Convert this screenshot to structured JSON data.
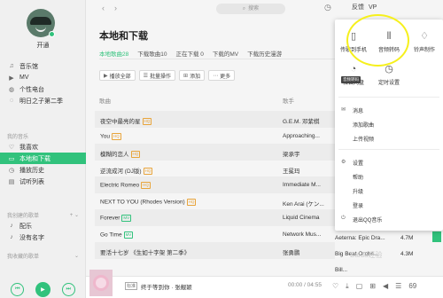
{
  "sidebar": {
    "username": "开通",
    "items": [
      {
        "icon": "♫",
        "label": "音乐馆"
      },
      {
        "icon": "▶",
        "label": "MV"
      },
      {
        "icon": "◍",
        "label": "个性电台"
      },
      {
        "icon": "◌",
        "label": "明日之子第二季"
      }
    ],
    "my_music_head": "我的音乐",
    "my_items": [
      {
        "icon": "♡",
        "label": "我喜欢"
      },
      {
        "icon": "▭",
        "label": "本地和下载"
      },
      {
        "icon": "◷",
        "label": "播放历史"
      },
      {
        "icon": "▤",
        "label": "试听列表"
      }
    ],
    "created_head": "我创建的歌单",
    "created_items": [
      {
        "icon": "♪",
        "label": "配乐"
      },
      {
        "icon": "♪",
        "label": "没有名字"
      }
    ],
    "collected_head": "我收藏的歌单"
  },
  "topbar": {
    "back": "‹",
    "forward": "›",
    "search_placeholder": "搜索",
    "feedback": "反馈",
    "vip": "VP"
  },
  "main": {
    "title": "本地和下载",
    "tabs": [
      "本地歌曲28",
      "下载歌曲10",
      "正在下载 0",
      "下载的MV",
      "下载历史漫游"
    ],
    "actions": [
      {
        "icon": "▶",
        "label": "播放全部"
      },
      {
        "icon": "☰",
        "label": "批量操作"
      },
      {
        "icon": "⊞",
        "label": "添加"
      },
      {
        "icon": "⋯",
        "label": "更多"
      }
    ],
    "headers": {
      "song": "歌曲",
      "artist": "歌手"
    },
    "rows": [
      {
        "title": "夜空中最亮的星",
        "tag": "HQ",
        "artist": "G.E.M. 邓紫棋"
      },
      {
        "title": "You",
        "tag": "HQ",
        "artist": "Approaching..."
      },
      {
        "title": "模糊的恋人",
        "tag": "HQ",
        "artist": "梁承宇"
      },
      {
        "title": "逆流成河 (DJ版)",
        "tag": "HQ",
        "artist": "王冕玛"
      },
      {
        "title": "Electric Romeo",
        "tag": "HQ",
        "artist": "Immediate M..."
      },
      {
        "title": "NEXT TO YOU (Rhodes Version)",
        "tag": "HQ",
        "artist": "Ken Arai (ケン..."
      },
      {
        "title": "Forever",
        "tag": "MV",
        "artist": "Liquid Cinema"
      },
      {
        "title": "Go Time",
        "tag": "MV",
        "artist": "Network Mus..."
      },
      {
        "title": "要活十七岁 《生如十字架 第二季》",
        "tag": "",
        "artist": "张勇鹏"
      }
    ]
  },
  "popup": {
    "grid": [
      {
        "icon": "▯",
        "label": "传歌到手机"
      },
      {
        "icon": "⦀",
        "label": "音频转码"
      },
      {
        "icon": "♢",
        "label": "铃声制作"
      },
      {
        "icon": "◔",
        "label": "微云网盘"
      },
      {
        "icon": "◷",
        "label": "定时设置"
      }
    ],
    "hint": "音频转码",
    "section1": [
      {
        "icon": "✉",
        "label": "消息"
      },
      {
        "icon": "",
        "label": "添加歌曲"
      },
      {
        "icon": "",
        "label": "上传视频"
      }
    ],
    "section2": [
      {
        "icon": "⚙",
        "label": "设置"
      },
      {
        "icon": "",
        "label": "帮助"
      },
      {
        "icon": "",
        "label": "升级"
      },
      {
        "icon": "",
        "label": "登录"
      },
      {
        "icon": "⏻",
        "label": "退出QQ音乐"
      }
    ]
  },
  "peek_rows": [
    {
      "album": "Aeterna: Epic Dra...",
      "size": "4.7M"
    },
    {
      "album": "Big Beat Orche...",
      "size": "4.3M"
    },
    {
      "album": "Bill...",
      "size": ""
    }
  ],
  "now_playing": {
    "badge": "标准",
    "title": "终于等到你 · 张靓颖",
    "time": "00:00 / 04:55",
    "count": "69"
  },
  "watermark": "Baidu经验"
}
